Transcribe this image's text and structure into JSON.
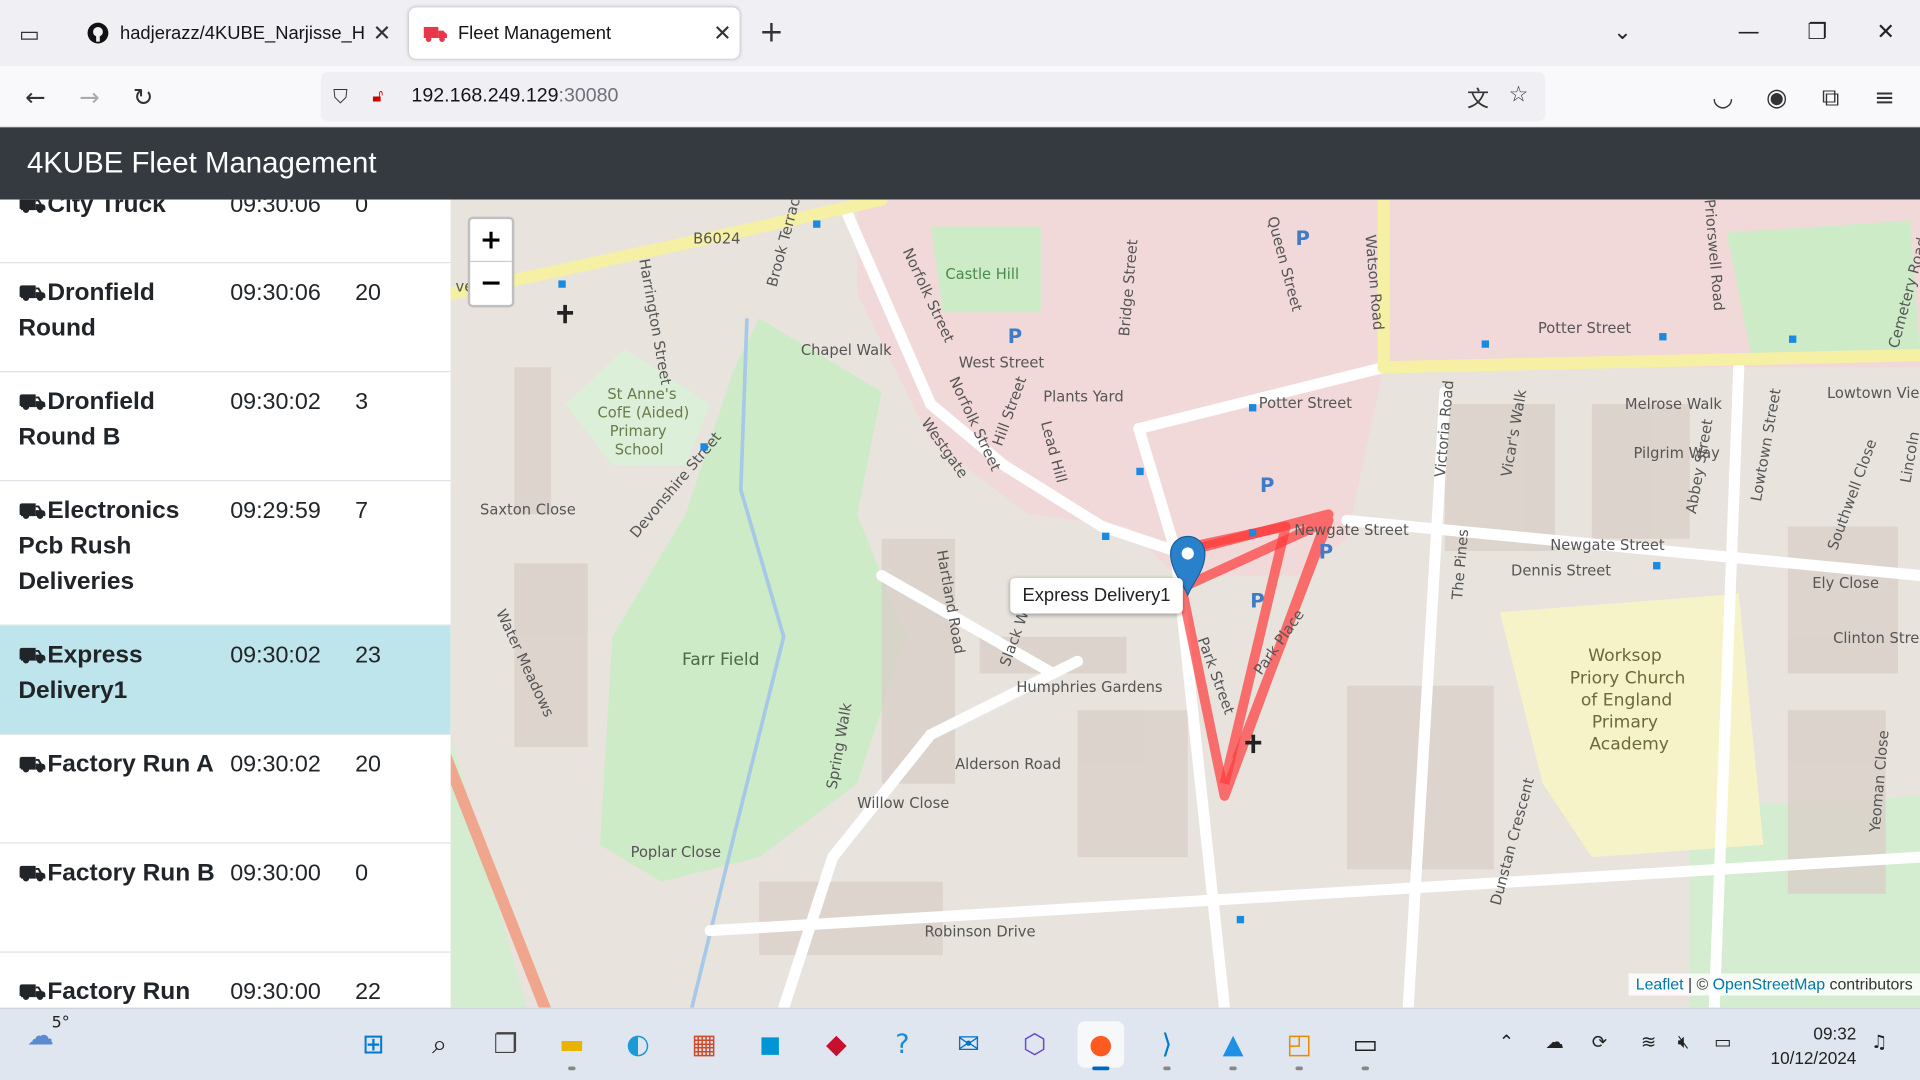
{
  "browser": {
    "tabs": [
      {
        "title": "hadjerazz/4KUBE_Narjisse_Hadj",
        "icon": "github-icon",
        "active": false
      },
      {
        "title": "Fleet Management",
        "icon": "truck-icon",
        "active": true
      }
    ],
    "url_host": "192.168.249.129",
    "url_port": ":30080"
  },
  "app": {
    "title": "4KUBE Fleet Management"
  },
  "fleet": {
    "rows": [
      {
        "name": "City Truck",
        "time": "09:30:06",
        "count": "0",
        "selected": false
      },
      {
        "name": "Dronfield Round",
        "time": "09:30:06",
        "count": "20",
        "selected": false
      },
      {
        "name": "Dronfield Round B",
        "time": "09:30:02",
        "count": "3",
        "selected": false
      },
      {
        "name": "Electronics Pcb Rush Deliveries",
        "time": "09:29:59",
        "count": "7",
        "selected": false
      },
      {
        "name": "Express Delivery1",
        "time": "09:30:02",
        "count": "23",
        "selected": true
      },
      {
        "name": "Factory Run A",
        "time": "09:30:02",
        "count": "20",
        "selected": false
      },
      {
        "name": "Factory Run B",
        "time": "09:30:00",
        "count": "0",
        "selected": false
      },
      {
        "name": "Factory Run",
        "time": "09:30:00",
        "count": "22",
        "selected": false
      }
    ]
  },
  "map": {
    "zoom_in": "+",
    "zoom_out": "−",
    "popup": "Express Delivery1",
    "attribution_leaflet": "Leaflet",
    "attribution_sep": " | © ",
    "attribution_osm": "OpenStreetMap",
    "attribution_tail": " contributors",
    "labels": {
      "b6024": "B6024",
      "castle_hill": "Castle Hill",
      "st_annes": "St Anne's",
      "st_annes2": "CofE (Aided)",
      "st_annes3": "Primary",
      "st_annes4": "School",
      "farr_field": "Farr Field",
      "potter_street": "Potter Street",
      "potter_street2": "Potter Street",
      "newgate": "Newgate Street",
      "newgate2": "Newgate Street",
      "dennis": "Dennis Street",
      "priory1": "Worksop",
      "priory2": "Priory Church",
      "priory3": "of England",
      "priory4": "Primary",
      "priory5": "Academy",
      "park_street": "Park Street",
      "park_place": "Park Place",
      "humphries": "Humphries Gardens",
      "alderson": "Alderson Road",
      "willow": "Willow Close",
      "robinson": "Robinson Drive",
      "poplar": "Poplar Close",
      "spring_walk": "Spring Walk",
      "water_meadows": "Water Meadows",
      "saxton": "Saxton Close",
      "devonshire": "Devonshire Street",
      "chapel_walk": "Chapel Walk",
      "brook_terrace": "Brook Terrace",
      "harrington": "Harrington Street",
      "norfolk": "Norfolk Street",
      "norfolk2": "Norfolk Street",
      "westgate": "Westgate",
      "west_street": "West Street",
      "plants_yard": "Plants Yard",
      "hill_street": "Hill Street",
      "lead_hill": "Lead Hill",
      "bridge_street": "Bridge Street",
      "queen_street": "Queen Street",
      "watson_road": "Watson Road",
      "hartland": "Hartland Road",
      "slack_walk": "Slack Walk",
      "victoria_road": "Victoria Road",
      "vicars_walk": "Vicar's Walk",
      "the_pines": "The Pines",
      "melrose": "Melrose Walk",
      "pilgrim": "Pilgrim Way",
      "abbey": "Abbey Street",
      "lowtown": "Lowtown Street",
      "lowtown_view": "Lowtown View",
      "southwell": "Southwell Close",
      "ely": "Ely Close",
      "clinton": "Clinton Street",
      "dunstan": "Dunstan Crescent",
      "yeoman": "Yeoman Close",
      "cemetery": "Cemetery Road",
      "priorswell": "Priorswell Road",
      "avenue": "venue",
      "lincoln": "Lincoln"
    }
  },
  "taskbar": {
    "weather": "5°",
    "time": "09:32",
    "date": "10/12/2024"
  },
  "colors": {
    "header_bg": "#343a40",
    "selected_row": "#bee5eb",
    "route": "#ff3b3b",
    "marker": "#2a81cb"
  }
}
